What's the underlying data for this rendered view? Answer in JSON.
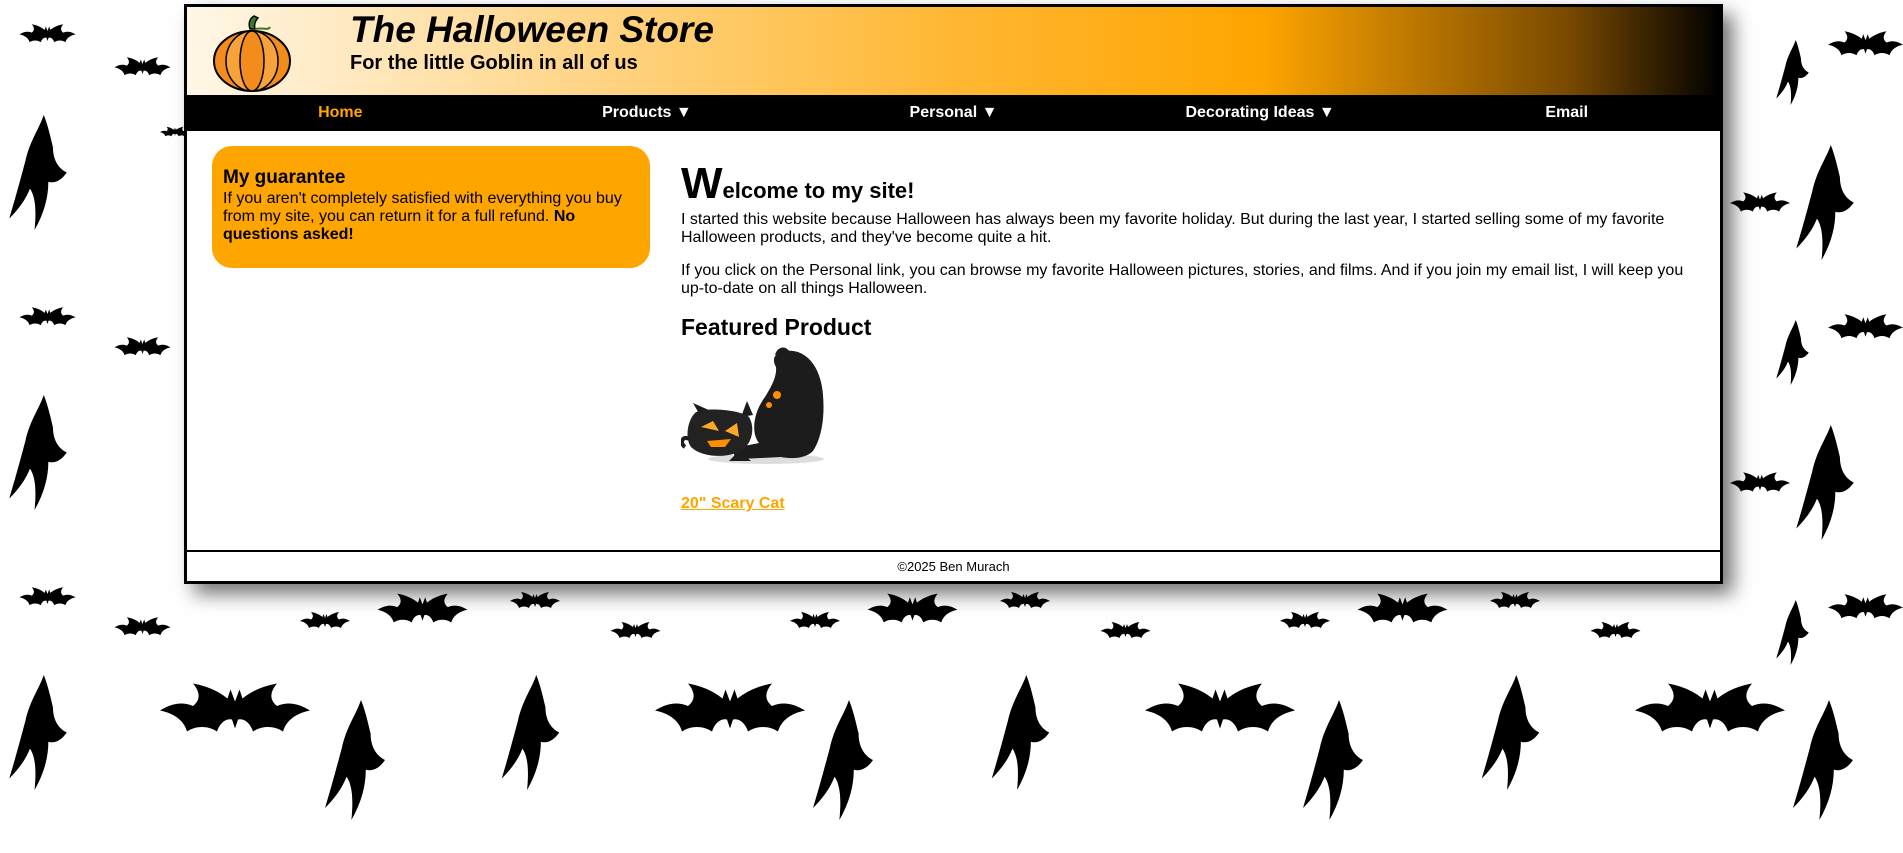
{
  "header": {
    "title": "The Halloween Store",
    "subtitle": "For the little Goblin in all of us",
    "logo_icon": "pumpkin-icon"
  },
  "nav": {
    "items": [
      {
        "label": "Home",
        "current": true
      },
      {
        "label": "Products ▼"
      },
      {
        "label": "Personal ▼"
      },
      {
        "label": "Decorating Ideas ▼"
      },
      {
        "label": "Email"
      }
    ]
  },
  "sidebar": {
    "heading": "My guarantee",
    "text": "If you aren't completely satisfied with everything you buy from my site, you can return it for a full refund.",
    "emphasis": "No questions asked!"
  },
  "main": {
    "welcome_initial": "W",
    "welcome_rest": "elcome to my site!",
    "paragraph1": "I started this website because Halloween has always been my favorite holiday. But during the last year, I started selling some of my favorite Halloween products, and they've become quite a hit.",
    "paragraph2": "If you click on the Personal link, you can browse my favorite Halloween pictures, stories, and films. And if you join my email list, I will keep you up-to-date on all things Halloween.",
    "featured_heading": "Featured Product",
    "product_image": "scary-cat-image",
    "product_link": "20\" Scary Cat"
  },
  "footer": {
    "copyright": "©2025 Ben Murach"
  },
  "colors": {
    "accent": "#ffa500",
    "nav_bg": "#000000",
    "background": "#ffffff"
  },
  "background_icon": "bat-icon"
}
